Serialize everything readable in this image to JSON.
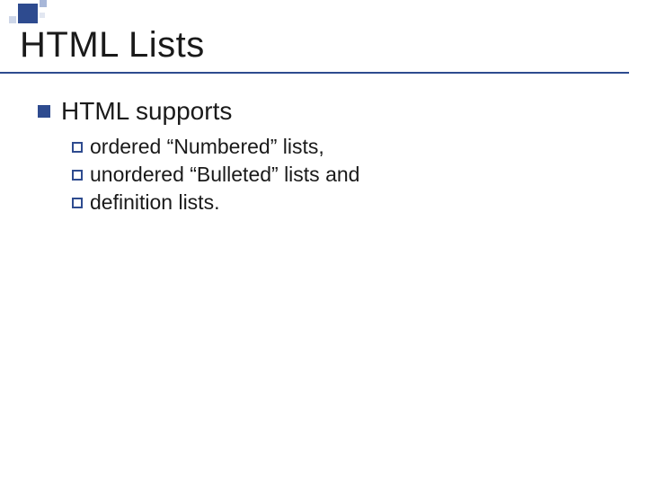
{
  "title": "HTML Lists",
  "level1": "HTML supports",
  "items": [
    "ordered “Numbered” lists,",
    "unordered “Bulleted” lists and",
    "definition lists."
  ]
}
